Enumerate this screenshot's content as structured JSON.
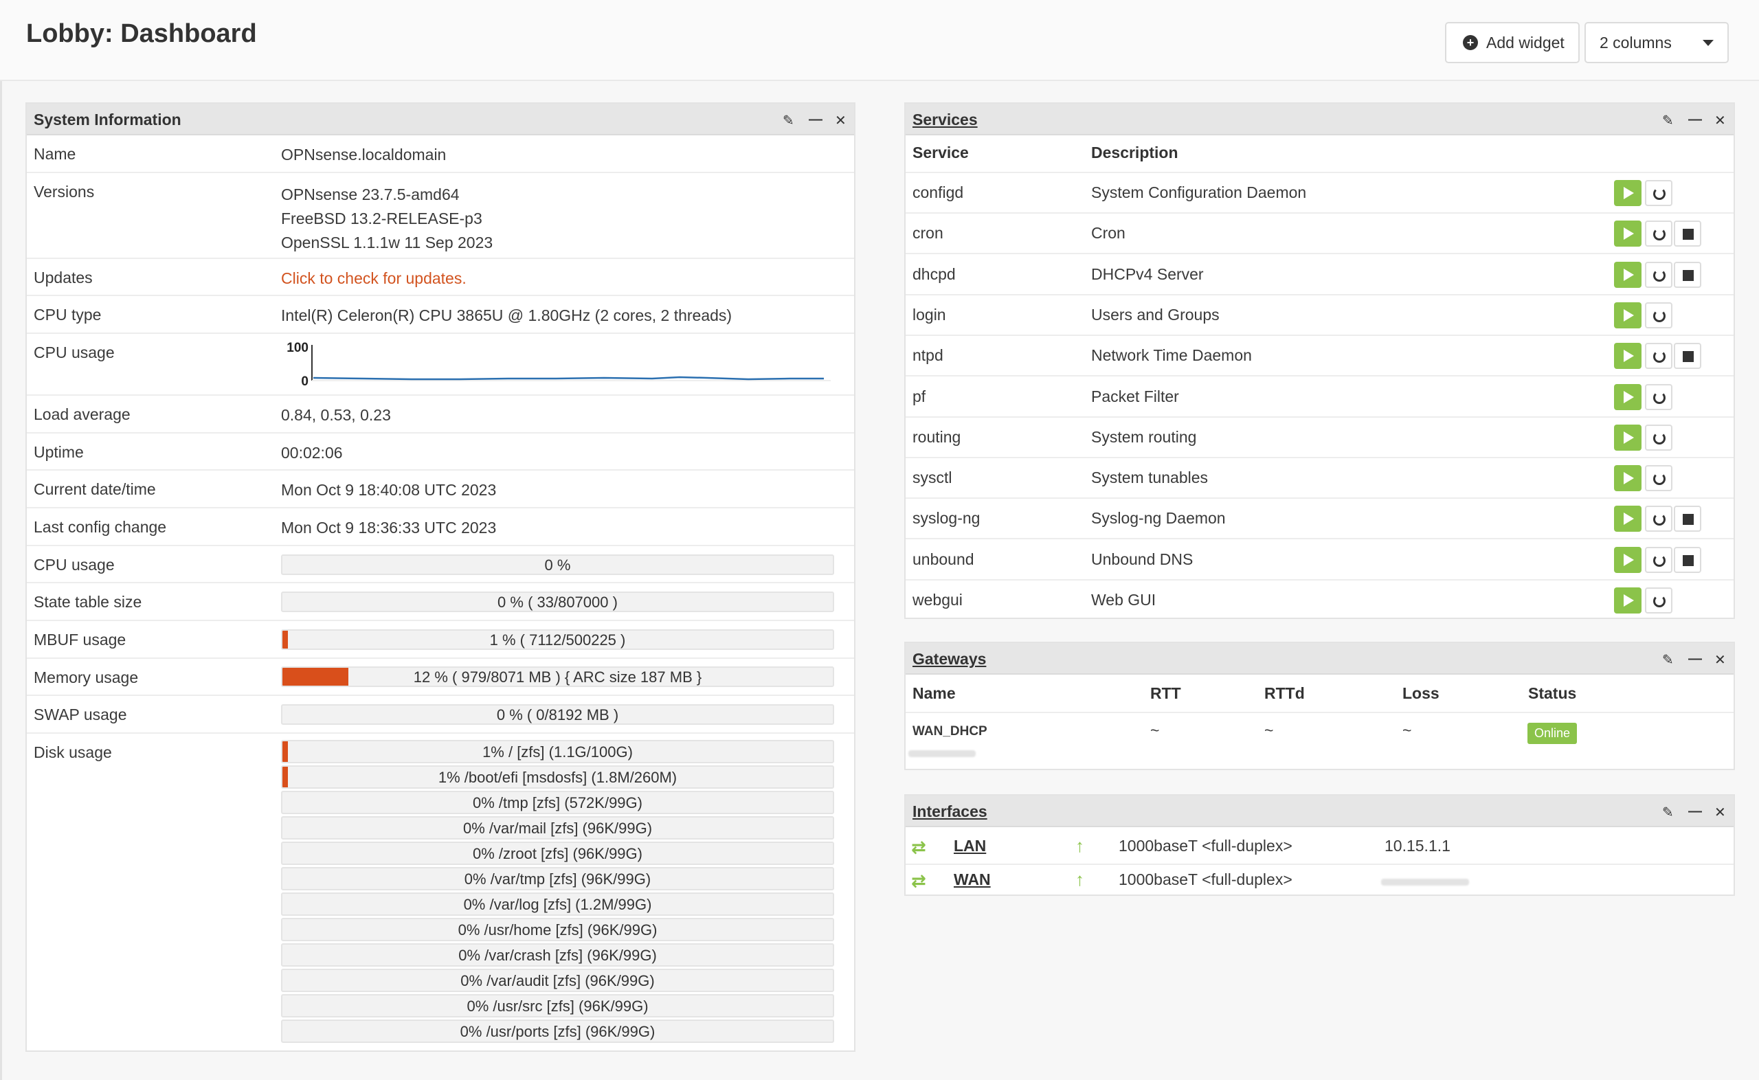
{
  "page": {
    "title": "Lobby: Dashboard"
  },
  "toolbar": {
    "add_widget": "Add widget",
    "columns": "2 columns"
  },
  "colors": {
    "accent": "#d94f1b",
    "ok": "#8bc34a",
    "link": "#d2531f"
  },
  "system_info": {
    "title": "System Information",
    "rows": {
      "name": {
        "label": "Name",
        "value": "OPNsense.localdomain"
      },
      "versions": {
        "label": "Versions",
        "lines": [
          "OPNsense 23.7.5-amd64",
          "FreeBSD 13.2-RELEASE-p3",
          "OpenSSL 1.1.1w 11 Sep 2023"
        ]
      },
      "updates": {
        "label": "Updates",
        "value": "Click to check for updates."
      },
      "cpu_type": {
        "label": "CPU type",
        "value": "Intel(R) Celeron(R) CPU 3865U @ 1.80GHz (2 cores, 2 threads)"
      },
      "cpu_usage_graph": {
        "label": "CPU usage",
        "y_max": "100",
        "y_min": "0"
      },
      "load_average": {
        "label": "Load average",
        "value": "0.84, 0.53, 0.23"
      },
      "uptime": {
        "label": "Uptime",
        "value": "00:02:06"
      },
      "datetime": {
        "label": "Current date/time",
        "value": "Mon Oct 9 18:40:08 UTC 2023"
      },
      "last_config": {
        "label": "Last config change",
        "value": "Mon Oct 9 18:36:33 UTC 2023"
      },
      "cpu_usage": {
        "label": "CPU usage",
        "text": "0 %",
        "percent": 0
      },
      "state_table": {
        "label": "State table size",
        "text": "0 % ( 33/807000 )",
        "percent": 0
      },
      "mbuf": {
        "label": "MBUF usage",
        "text": "1 % ( 7112/500225 )",
        "percent": 1
      },
      "memory": {
        "label": "Memory usage",
        "text": "12 % ( 979/8071 MB ) { ARC size 187 MB }",
        "percent": 12
      },
      "swap": {
        "label": "SWAP usage",
        "text": "0 % ( 0/8192 MB )",
        "percent": 0
      },
      "disk": {
        "label": "Disk usage",
        "items": [
          {
            "text": "1% / [zfs] (1.1G/100G)",
            "percent": 1
          },
          {
            "text": "1% /boot/efi [msdosfs] (1.8M/260M)",
            "percent": 1
          },
          {
            "text": "0% /tmp [zfs] (572K/99G)",
            "percent": 0
          },
          {
            "text": "0% /var/mail [zfs] (96K/99G)",
            "percent": 0
          },
          {
            "text": "0% /zroot [zfs] (96K/99G)",
            "percent": 0
          },
          {
            "text": "0% /var/tmp [zfs] (96K/99G)",
            "percent": 0
          },
          {
            "text": "0% /var/log [zfs] (1.2M/99G)",
            "percent": 0
          },
          {
            "text": "0% /usr/home [zfs] (96K/99G)",
            "percent": 0
          },
          {
            "text": "0% /var/crash [zfs] (96K/99G)",
            "percent": 0
          },
          {
            "text": "0% /var/audit [zfs] (96K/99G)",
            "percent": 0
          },
          {
            "text": "0% /usr/src [zfs] (96K/99G)",
            "percent": 0
          },
          {
            "text": "0% /usr/ports [zfs] (96K/99G)",
            "percent": 0
          }
        ]
      }
    }
  },
  "services": {
    "title": "Services",
    "headers": {
      "service": "Service",
      "description": "Description"
    },
    "rows": [
      {
        "name": "configd",
        "desc": "System Configuration Daemon",
        "stop": false
      },
      {
        "name": "cron",
        "desc": "Cron",
        "stop": true
      },
      {
        "name": "dhcpd",
        "desc": "DHCPv4 Server",
        "stop": true
      },
      {
        "name": "login",
        "desc": "Users and Groups",
        "stop": false
      },
      {
        "name": "ntpd",
        "desc": "Network Time Daemon",
        "stop": true
      },
      {
        "name": "pf",
        "desc": "Packet Filter",
        "stop": false
      },
      {
        "name": "routing",
        "desc": "System routing",
        "stop": false
      },
      {
        "name": "sysctl",
        "desc": "System tunables",
        "stop": false
      },
      {
        "name": "syslog-ng",
        "desc": "Syslog-ng Daemon",
        "stop": true
      },
      {
        "name": "unbound",
        "desc": "Unbound DNS",
        "stop": true
      },
      {
        "name": "webgui",
        "desc": "Web GUI",
        "stop": false
      }
    ]
  },
  "gateways": {
    "title": "Gateways",
    "headers": {
      "name": "Name",
      "rtt": "RTT",
      "rttd": "RTTd",
      "loss": "Loss",
      "status": "Status"
    },
    "rows": [
      {
        "name": "WAN_DHCP",
        "rtt": "~",
        "rttd": "~",
        "loss": "~",
        "status": "Online"
      }
    ]
  },
  "interfaces": {
    "title": "Interfaces",
    "rows": [
      {
        "name": "LAN",
        "media": "1000baseT <full-duplex>",
        "ip": "10.15.1.1"
      },
      {
        "name": "WAN",
        "media": "1000baseT <full-duplex>",
        "ip": ""
      }
    ]
  }
}
